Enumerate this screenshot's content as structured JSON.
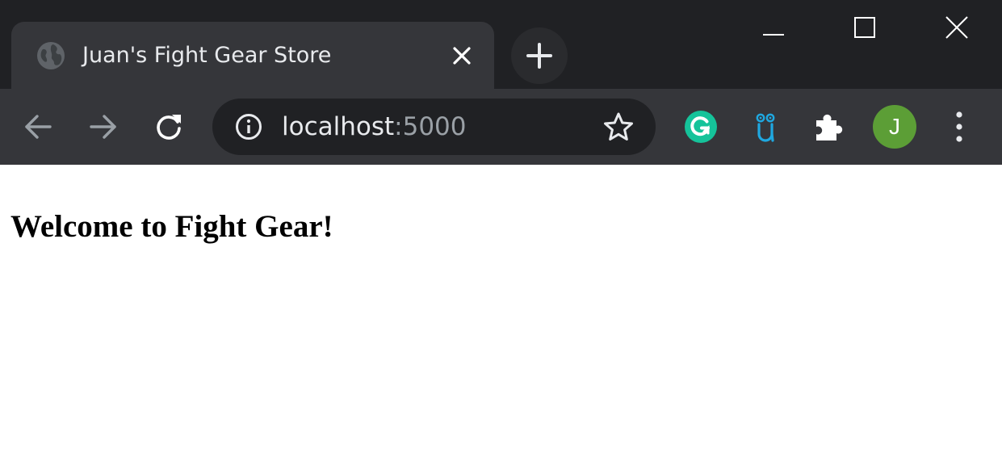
{
  "browser": {
    "tab": {
      "title": "Juan's Fight Gear Store",
      "favicon_icon": "globe-icon",
      "close_icon": "close-icon"
    },
    "new_tab_icon": "plus-icon",
    "window_controls": [
      "minimize-icon",
      "maximize-icon",
      "close-icon"
    ],
    "nav": {
      "back_icon": "arrow-left-icon",
      "forward_icon": "arrow-right-icon",
      "reload_icon": "reload-icon"
    },
    "address_bar": {
      "info_icon": "info-icon",
      "host": "localhost",
      "port": ":5000",
      "bookmark_icon": "star-icon"
    },
    "extensions": [
      "grammarly-icon",
      "owl-extension-icon",
      "puzzle-icon"
    ],
    "profile": {
      "initial": "J"
    },
    "menu_icon": "kebab-menu-icon"
  },
  "page": {
    "heading": "Welcome to Fight Gear!"
  },
  "colors": {
    "tabstrip": "#202124",
    "toolbar": "#35363a",
    "omnibox": "#202124",
    "grammarly": "#15c39a",
    "owl": "#1fa8e0",
    "avatar": "#5c9e36"
  }
}
